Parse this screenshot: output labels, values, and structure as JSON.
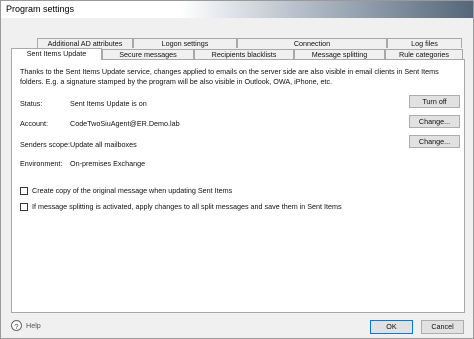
{
  "window": {
    "title": "Program settings"
  },
  "tabs": {
    "row1": [
      {
        "label": "Additional AD attributes"
      },
      {
        "label": "Logon settings"
      },
      {
        "label": "Connection"
      },
      {
        "label": "Log files"
      }
    ],
    "row2": [
      {
        "label": "Sent Items Update"
      },
      {
        "label": "Secure messages"
      },
      {
        "label": "Recipients blacklists"
      },
      {
        "label": "Message splitting"
      },
      {
        "label": "Rule categories"
      }
    ]
  },
  "panel": {
    "description": "Thanks to the Sent Items Update service, changes applied to emails on the server side are also visible in email clients in Sent Items folders. E.g. a signature stamped by the program will be also visible in Outlook, OWA, iPhone, etc.",
    "status": {
      "label": "Status:",
      "value": "Sent Items Update is on",
      "button": "Turn off"
    },
    "account": {
      "label": "Account:",
      "value": "CodeTwoSiuAgent@ER.Demo.lab",
      "button": "Change..."
    },
    "senders_scope": {
      "label": "Senders scope:",
      "value": "Update all mailboxes",
      "button": "Change..."
    },
    "environment": {
      "label": "Environment:",
      "value": "On-premises Exchange"
    },
    "checkboxes": [
      {
        "label": "Create copy of the original message when updating Sent Items",
        "checked": false
      },
      {
        "label": "If message splitting is activated, apply changes to all split messages and save them in Sent Items",
        "checked": false
      }
    ]
  },
  "footer": {
    "help": "Help",
    "ok": "OK",
    "cancel": "Cancel"
  }
}
